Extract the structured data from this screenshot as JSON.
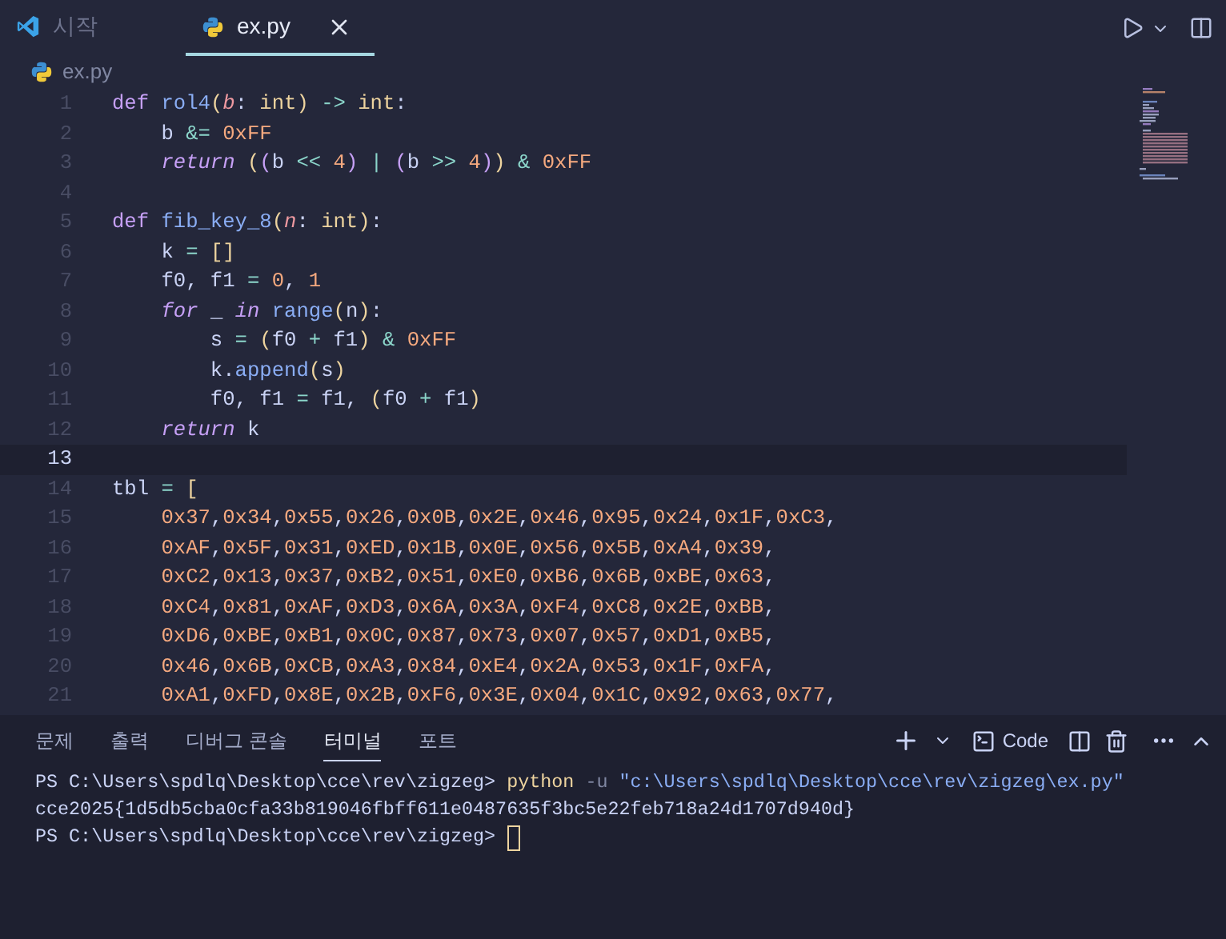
{
  "editor_tabs": [
    {
      "label": "시작",
      "kind": "welcome",
      "selected": false
    },
    {
      "label": "ex.py",
      "kind": "python",
      "selected": true
    }
  ],
  "breadcrumb": {
    "label": "ex.py"
  },
  "code": {
    "lines": [
      {
        "number": "1",
        "current": false,
        "tokens": [
          {
            "kind": "keyword",
            "text": "def "
          },
          {
            "kind": "function",
            "text": "rol4"
          },
          {
            "kind": "bracket1",
            "text": "("
          },
          {
            "kind": "param",
            "text": "b"
          },
          {
            "kind": "text",
            "text": ": "
          },
          {
            "kind": "type",
            "text": "int"
          },
          {
            "kind": "bracket1",
            "text": ") "
          },
          {
            "kind": "operator",
            "text": "-> "
          },
          {
            "kind": "type",
            "text": "int"
          },
          {
            "kind": "text",
            "text": ":"
          }
        ]
      },
      {
        "number": "2",
        "current": false,
        "tokens": [
          {
            "kind": "text",
            "text": "    b "
          },
          {
            "kind": "operator",
            "text": "&= "
          },
          {
            "kind": "number",
            "text": "0xFF"
          }
        ]
      },
      {
        "number": "3",
        "current": false,
        "tokens": [
          {
            "kind": "keyword_italic",
            "text": "    return "
          },
          {
            "kind": "bracket1",
            "text": "("
          },
          {
            "kind": "bracket2",
            "text": "("
          },
          {
            "kind": "text",
            "text": "b "
          },
          {
            "kind": "operator",
            "text": "<< "
          },
          {
            "kind": "number",
            "text": "4"
          },
          {
            "kind": "bracket2",
            "text": ") "
          },
          {
            "kind": "operator",
            "text": "| "
          },
          {
            "kind": "bracket2",
            "text": "("
          },
          {
            "kind": "text",
            "text": "b "
          },
          {
            "kind": "operator",
            "text": ">> "
          },
          {
            "kind": "number",
            "text": "4"
          },
          {
            "kind": "bracket2",
            "text": ")"
          },
          {
            "kind": "bracket1",
            "text": ") "
          },
          {
            "kind": "operator",
            "text": "& "
          },
          {
            "kind": "number",
            "text": "0xFF"
          }
        ]
      },
      {
        "number": "4",
        "current": false
      },
      {
        "number": "5",
        "current": false,
        "tokens": [
          {
            "kind": "keyword",
            "text": "def "
          },
          {
            "kind": "function",
            "text": "fib_key_8"
          },
          {
            "kind": "bracket1",
            "text": "("
          },
          {
            "kind": "param",
            "text": "n"
          },
          {
            "kind": "text",
            "text": ": "
          },
          {
            "kind": "type",
            "text": "int"
          },
          {
            "kind": "bracket1",
            "text": ")"
          },
          {
            "kind": "text",
            "text": ":"
          }
        ]
      },
      {
        "number": "6",
        "current": false,
        "tokens": [
          {
            "kind": "text",
            "text": "    k "
          },
          {
            "kind": "operator",
            "text": "= "
          },
          {
            "kind": "bracket1",
            "text": "[]"
          }
        ]
      },
      {
        "number": "7",
        "current": false,
        "tokens": [
          {
            "kind": "text",
            "text": "    f0, f1 "
          },
          {
            "kind": "operator",
            "text": "= "
          },
          {
            "kind": "number",
            "text": "0"
          },
          {
            "kind": "text",
            "text": ", "
          },
          {
            "kind": "number",
            "text": "1"
          }
        ]
      },
      {
        "number": "8",
        "current": false,
        "tokens": [
          {
            "kind": "keyword_italic",
            "text": "    for"
          },
          {
            "kind": "text",
            "text": " _ "
          },
          {
            "kind": "keyword_italic",
            "text": "in "
          },
          {
            "kind": "builtin",
            "text": "range"
          },
          {
            "kind": "bracket1",
            "text": "("
          },
          {
            "kind": "text",
            "text": "n"
          },
          {
            "kind": "bracket1",
            "text": ")"
          },
          {
            "kind": "text",
            "text": ":"
          }
        ]
      },
      {
        "number": "9",
        "current": false,
        "tokens": [
          {
            "kind": "text",
            "text": "        s "
          },
          {
            "kind": "operator",
            "text": "= "
          },
          {
            "kind": "bracket1",
            "text": "("
          },
          {
            "kind": "text",
            "text": "f0 "
          },
          {
            "kind": "operator",
            "text": "+"
          },
          {
            "kind": "text",
            "text": " f1"
          },
          {
            "kind": "bracket1",
            "text": ") "
          },
          {
            "kind": "operator",
            "text": "& "
          },
          {
            "kind": "number",
            "text": "0xFF"
          }
        ]
      },
      {
        "number": "10",
        "current": false,
        "tokens": [
          {
            "kind": "text",
            "text": "        k."
          },
          {
            "kind": "function",
            "text": "append"
          },
          {
            "kind": "bracket1",
            "text": "("
          },
          {
            "kind": "text",
            "text": "s"
          },
          {
            "kind": "bracket1",
            "text": ")"
          }
        ]
      },
      {
        "number": "11",
        "current": false,
        "tokens": [
          {
            "kind": "text",
            "text": "        f0, f1 "
          },
          {
            "kind": "operator",
            "text": "="
          },
          {
            "kind": "text",
            "text": " f1, "
          },
          {
            "kind": "bracket1",
            "text": "("
          },
          {
            "kind": "text",
            "text": "f0 "
          },
          {
            "kind": "operator",
            "text": "+"
          },
          {
            "kind": "text",
            "text": " f1"
          },
          {
            "kind": "bracket1",
            "text": ")"
          }
        ]
      },
      {
        "number": "12",
        "current": false,
        "tokens": [
          {
            "kind": "keyword_italic",
            "text": "    return"
          },
          {
            "kind": "text",
            "text": " k"
          }
        ]
      },
      {
        "number": "13",
        "current": true
      },
      {
        "number": "14",
        "current": false,
        "tokens": [
          {
            "kind": "text",
            "text": "tbl "
          },
          {
            "kind": "operator",
            "text": "= "
          },
          {
            "kind": "bracket1",
            "text": "["
          }
        ]
      },
      {
        "number": "15",
        "current": false,
        "tokens": [
          {
            "kind": "number_list",
            "text": "    0x37,0x34,0x55,0x26,0x0B,0x2E,0x46,0x95,0x24,0x1F,0xC3,"
          }
        ]
      },
      {
        "number": "16",
        "current": false,
        "tokens": [
          {
            "kind": "number_list",
            "text": "    0xAF,0x5F,0x31,0xED,0x1B,0x0E,0x56,0x5B,0xA4,0x39,"
          }
        ]
      },
      {
        "number": "17",
        "current": false,
        "tokens": [
          {
            "kind": "number_list",
            "text": "    0xC2,0x13,0x37,0xB2,0x51,0xE0,0xB6,0x6B,0xBE,0x63,"
          }
        ]
      },
      {
        "number": "18",
        "current": false,
        "tokens": [
          {
            "kind": "number_list",
            "text": "    0xC4,0x81,0xAF,0xD3,0x6A,0x3A,0xF4,0xC8,0x2E,0xBB,"
          }
        ]
      },
      {
        "number": "19",
        "current": false,
        "tokens": [
          {
            "kind": "number_list",
            "text": "    0xD6,0xBE,0xB1,0x0C,0x87,0x73,0x07,0x57,0xD1,0xB5,"
          }
        ]
      },
      {
        "number": "20",
        "current": false,
        "tokens": [
          {
            "kind": "number_list",
            "text": "    0x46,0x6B,0xCB,0xA3,0x84,0xE4,0x2A,0x53,0x1F,0xFA,"
          }
        ]
      },
      {
        "number": "21",
        "current": false,
        "tokens": [
          {
            "kind": "number_list",
            "text": "    0xA1,0xFD,0x8E,0x2B,0xF6,0x3E,0x04,0x1C,0x92,0x63,0x77,"
          }
        ]
      }
    ]
  },
  "panel": {
    "tabs": [
      {
        "label": "문제",
        "selected": false
      },
      {
        "label": "출력",
        "selected": false
      },
      {
        "label": "디버그 콘솔",
        "selected": false
      },
      {
        "label": "터미널",
        "selected": true
      },
      {
        "label": "포트",
        "selected": false
      }
    ],
    "terminal_button": {
      "label": "Code"
    },
    "terminal_lines": [
      {
        "cursor": false,
        "tokens": [
          {
            "kind": "prompt",
            "text": "PS C:\\Users\\spdlq\\Desktop\\cce\\rev\\zigzeg> "
          },
          {
            "kind": "command",
            "text": "python "
          },
          {
            "kind": "flag",
            "text": "-u "
          },
          {
            "kind": "string",
            "text": "\"c:\\Users\\spdlq\\Desktop\\cce\\rev\\zigzeg\\ex.py\""
          }
        ]
      },
      {
        "cursor": false,
        "tokens": [
          {
            "kind": "output",
            "text": "cce2025{1d5db5cba0cfa33b819046fbff611e0487635f3bc5e22feb718a24d1707d940d}"
          }
        ]
      },
      {
        "cursor": true,
        "tokens": [
          {
            "kind": "prompt",
            "text": "PS C:\\Users\\spdlq\\Desktop\\cce\\rev\\zigzeg> "
          }
        ]
      }
    ]
  }
}
